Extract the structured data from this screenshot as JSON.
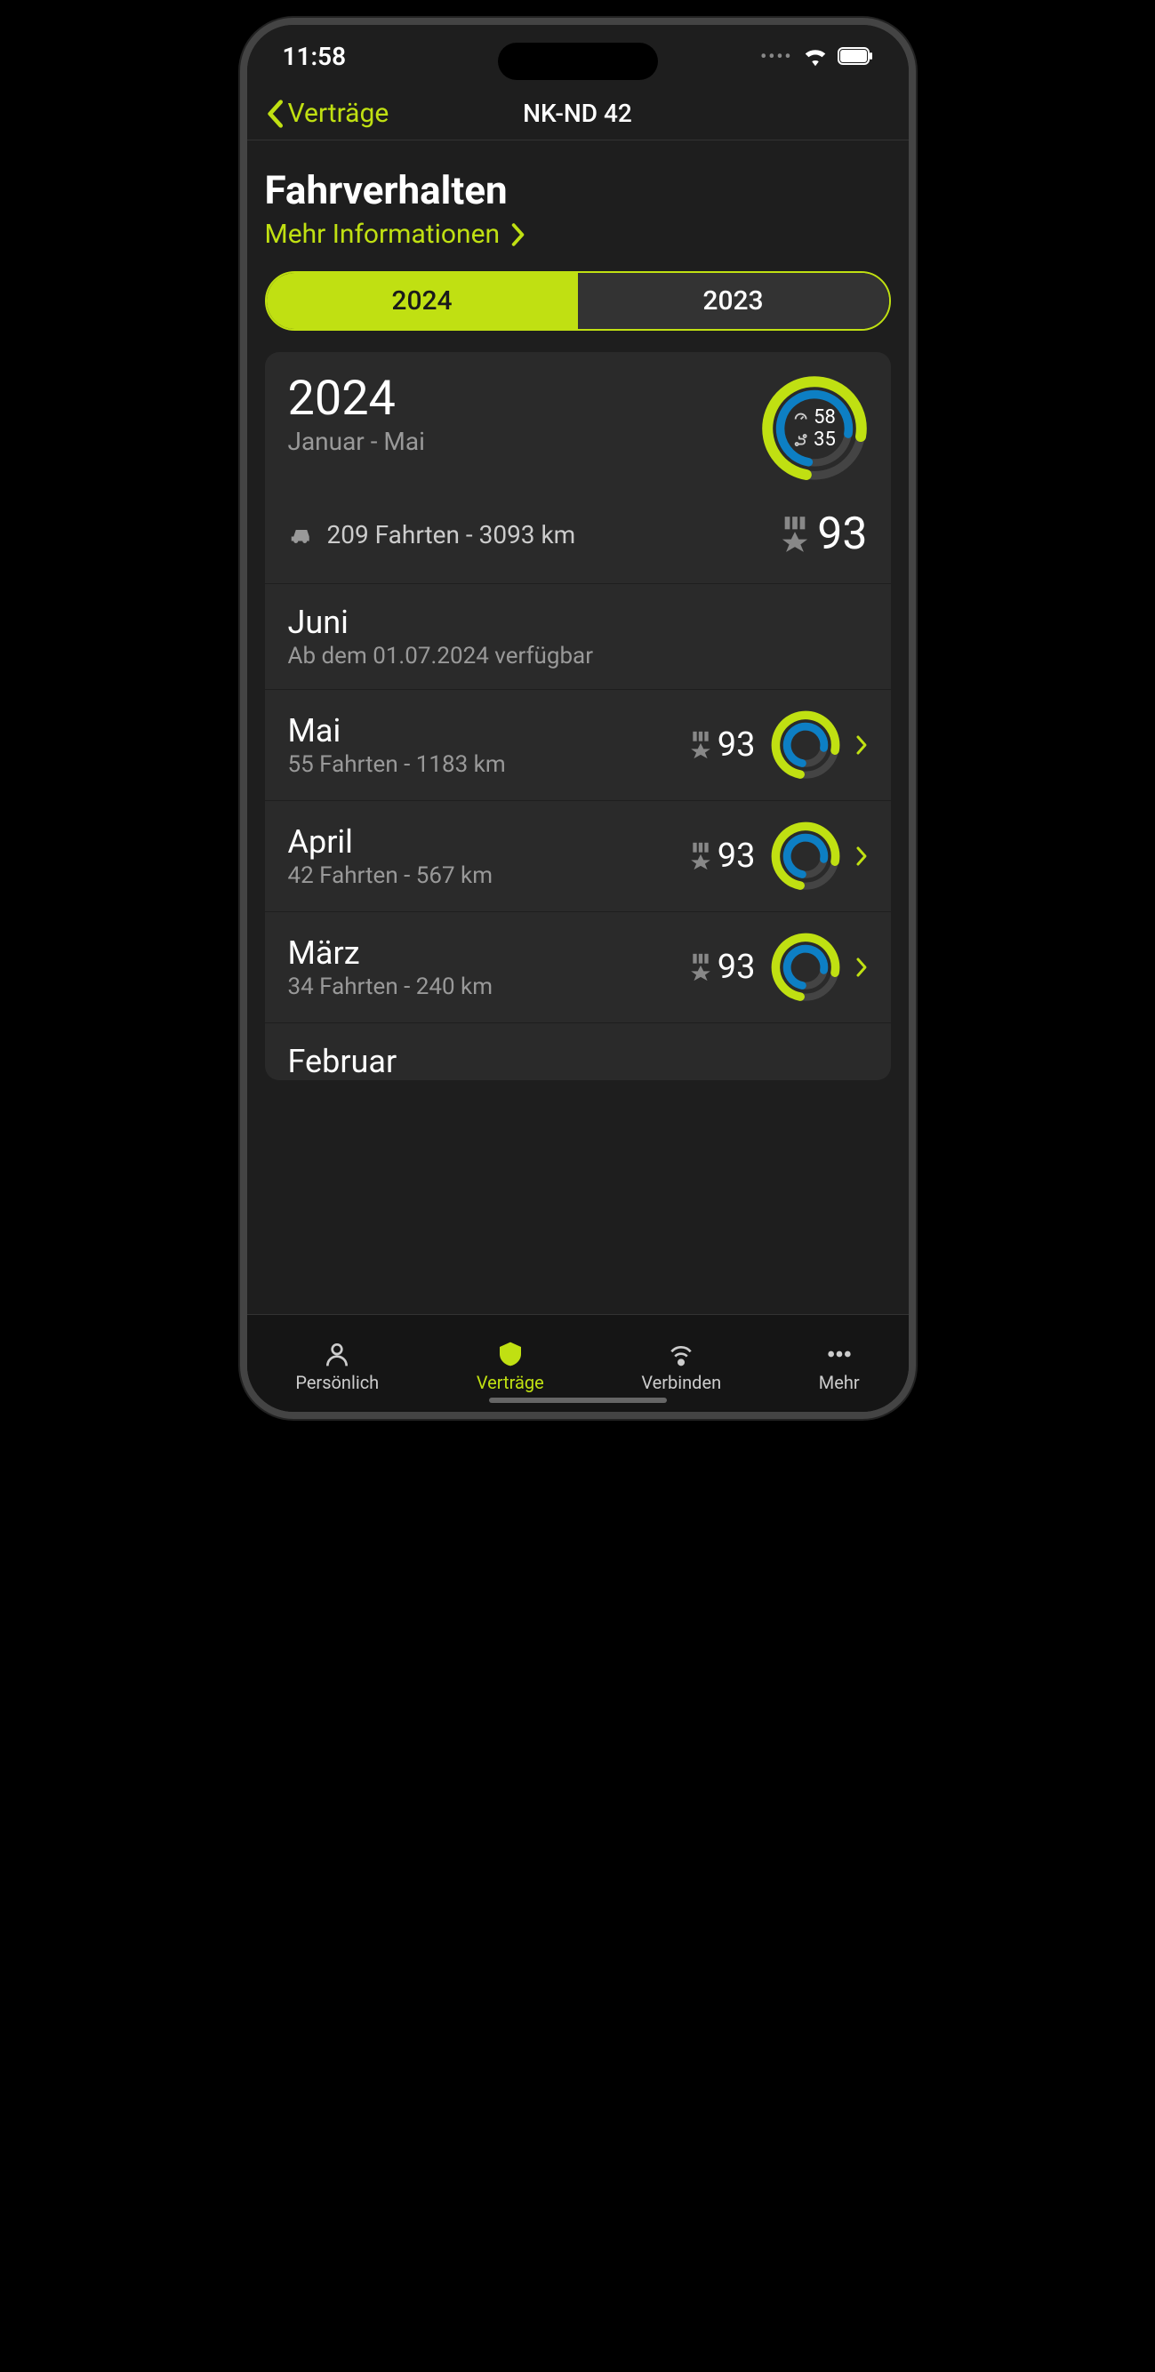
{
  "status": {
    "time": "11:58"
  },
  "nav": {
    "back": "Verträge",
    "title": "NK-ND 42"
  },
  "header": {
    "title": "Fahrverhalten",
    "more": "Mehr Informationen"
  },
  "tabs": {
    "y1": "2024",
    "y2": "2023"
  },
  "summary": {
    "year": "2024",
    "range": "Januar - Mai",
    "trips": "209 Fahrten - 3093 km",
    "score": "93",
    "stat1": "58",
    "stat2": "35"
  },
  "pending": {
    "month": "Juni",
    "note": "Ab dem 01.07.2024 verfügbar"
  },
  "months": [
    {
      "name": "Mai",
      "sub": "55 Fahrten - 1183 km",
      "score": "93"
    },
    {
      "name": "April",
      "sub": "42 Fahrten - 567 km",
      "score": "93"
    },
    {
      "name": "März",
      "sub": "34 Fahrten - 240 km",
      "score": "93"
    },
    {
      "name": "Februar",
      "sub": "",
      "score": ""
    }
  ],
  "tabbar": {
    "t1": "Persönlich",
    "t2": "Verträge",
    "t3": "Verbinden",
    "t4": "Mehr"
  }
}
